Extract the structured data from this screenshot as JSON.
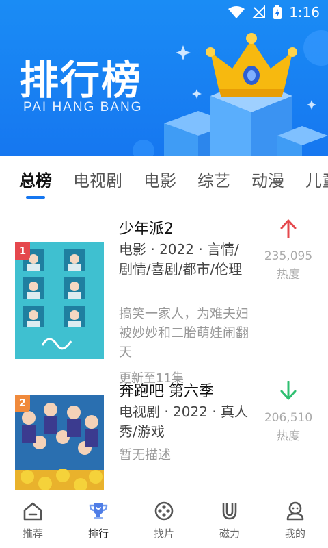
{
  "status_bar": {
    "time": "1:16"
  },
  "banner": {
    "title": "排行榜",
    "subtitle": "PAI HANG BANG",
    "colors": {
      "background": "#1677f0",
      "crown": "#f7b90f"
    }
  },
  "tabs": [
    {
      "label": "总榜",
      "active": true
    },
    {
      "label": "电视剧",
      "active": false
    },
    {
      "label": "电影",
      "active": false
    },
    {
      "label": "综艺",
      "active": false
    },
    {
      "label": "动漫",
      "active": false
    },
    {
      "label": "儿童",
      "active": false
    }
  ],
  "items": [
    {
      "rank": "1",
      "rank_color": "#e5484d",
      "title": "少年派2",
      "meta": "电影 · 2022 · 言情/剧情/喜剧/都市/伦理",
      "description": "搞笑一家人，为难夫妇被妙妙和二胎萌娃闹翻天",
      "update": "更新至11集",
      "trend": "up",
      "trend_color": "#e5484d",
      "heat": "235,095",
      "heat_label": "热度"
    },
    {
      "rank": "2",
      "rank_color": "#f08a3c",
      "title": "奔跑吧 第六季",
      "meta": "电视剧 · 2022 · 真人秀/游戏",
      "description": "暂无描述",
      "update": "",
      "trend": "down",
      "trend_color": "#2fbf71",
      "heat": "206,510",
      "heat_label": "热度"
    }
  ],
  "bottom_nav": [
    {
      "label": "推荐",
      "icon": "home-icon",
      "active": false
    },
    {
      "label": "排行",
      "icon": "trophy-icon",
      "active": true
    },
    {
      "label": "找片",
      "icon": "film-reel-icon",
      "active": false
    },
    {
      "label": "磁力",
      "icon": "magnet-icon",
      "active": false
    },
    {
      "label": "我的",
      "icon": "user-icon",
      "active": false
    }
  ]
}
